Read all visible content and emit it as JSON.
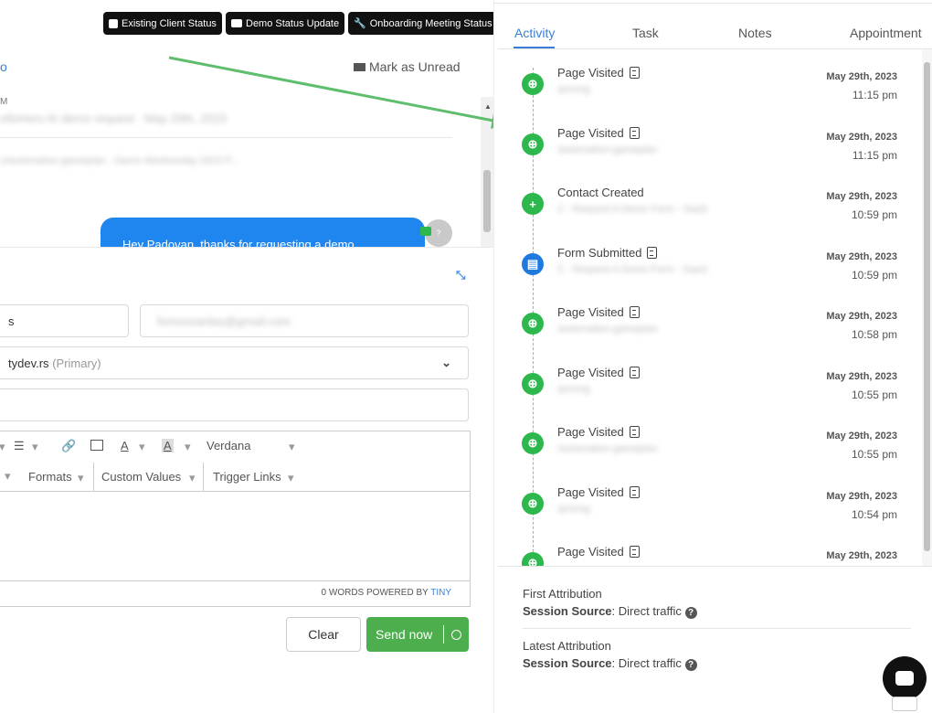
{
  "top_buttons": [
    {
      "label": "Existing Client Status"
    },
    {
      "label": "Demo Status Update"
    },
    {
      "label": "Onboarding Meeting Status"
    }
  ],
  "conversation": {
    "left_link": "o",
    "mark_unread": "Mark as Unread",
    "header_fragment": "M",
    "blurred_line_1": "elloHero AI demo request · May 29th, 2023",
    "blurred_line_2": "u/automation-gameplan · Demo Wednesday 2023 P...",
    "bubble_text": "Hey Padovan, thanks for requesting a demo",
    "avatar_text": "?"
  },
  "compose": {
    "from_field": "s",
    "to_field_blurred": "fornossanlas@gmail.com",
    "email_select": "tydev.rs",
    "email_select_tag": "(Primary)",
    "toolbar_font": "Verdana",
    "formats_label": "Formats",
    "custom_values_label": "Custom Values",
    "trigger_links_label": "Trigger Links",
    "word_count": "0 WORDS POWERED BY",
    "tiny": "TINY",
    "clear_label": "Clear",
    "send_label": "Send now"
  },
  "activity": {
    "tabs": [
      "Activity",
      "Task",
      "Notes",
      "Appointment"
    ],
    "items": [
      {
        "title": "Page Visited",
        "sub": "/pricing",
        "date": "May 29th, 2023",
        "time": "11:15 pm",
        "icon": "globe-icon",
        "color": "#2db84d"
      },
      {
        "title": "Page Visited",
        "sub": "/automation-gameplan",
        "date": "May 29th, 2023",
        "time": "11:15 pm",
        "icon": "globe-icon",
        "color": "#2db84d"
      },
      {
        "title": "Contact Created",
        "sub": "Z - Request A Demo Form - SaaS",
        "date": "May 29th, 2023",
        "time": "10:59 pm",
        "icon": "add-user-icon",
        "color": "#2db84d"
      },
      {
        "title": "Form Submitted",
        "sub": "Z - Request A Demo Form - SaaS",
        "date": "May 29th, 2023",
        "time": "10:59 pm",
        "icon": "clipboard-icon",
        "color": "#1f7ae0"
      },
      {
        "title": "Page Visited",
        "sub": "/automation-gameplan",
        "date": "May 29th, 2023",
        "time": "10:58 pm",
        "icon": "globe-icon",
        "color": "#2db84d"
      },
      {
        "title": "Page Visited",
        "sub": "/pricing",
        "date": "May 29th, 2023",
        "time": "10:55 pm",
        "icon": "globe-icon",
        "color": "#2db84d"
      },
      {
        "title": "Page Visited",
        "sub": "/automation-gameplan",
        "date": "May 29th, 2023",
        "time": "10:55 pm",
        "icon": "globe-icon",
        "color": "#2db84d"
      },
      {
        "title": "Page Visited",
        "sub": "/pricing",
        "date": "May 29th, 2023",
        "time": "10:54 pm",
        "icon": "globe-icon",
        "color": "#2db84d"
      },
      {
        "title": "Page Visited",
        "sub": "",
        "date": "May 29th, 2023",
        "time": "",
        "icon": "globe-icon",
        "color": "#2db84d"
      }
    ]
  },
  "attribution": {
    "first_title": "First Attribution",
    "first_label": "Session Source",
    "first_value": ": Direct traffic",
    "latest_title": "Latest Attribution",
    "latest_label": "Session Source",
    "latest_value": ": Direct traffic"
  },
  "colors": {
    "accent_green": "#4cae4c",
    "activity_blue": "#1f7ae0",
    "bubble_blue": "#1f86f0"
  }
}
